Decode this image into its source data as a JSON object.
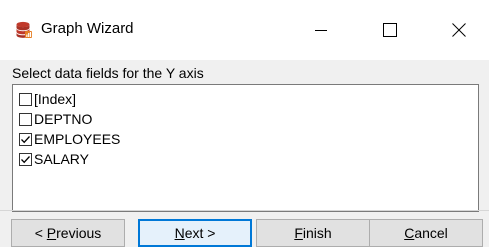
{
  "window": {
    "title": "Graph Wizard",
    "icon": "database-icon"
  },
  "prompt": "Select data fields for the Y axis",
  "fields": [
    {
      "label": "[Index]",
      "checked": false
    },
    {
      "label": "DEPTNO",
      "checked": false
    },
    {
      "label": "EMPLOYEES",
      "checked": true
    },
    {
      "label": "SALARY",
      "checked": true
    }
  ],
  "buttons": {
    "previous": {
      "before": "< ",
      "mnemonic": "P",
      "after": "revious"
    },
    "next": {
      "before": "",
      "mnemonic": "N",
      "after": "ext >"
    },
    "finish": {
      "before": "",
      "mnemonic": "F",
      "after": "inish"
    },
    "cancel": {
      "before": "",
      "mnemonic": "C",
      "after": "ancel"
    }
  },
  "colors": {
    "accent": "#0078d7",
    "icon": "#c0392b"
  }
}
